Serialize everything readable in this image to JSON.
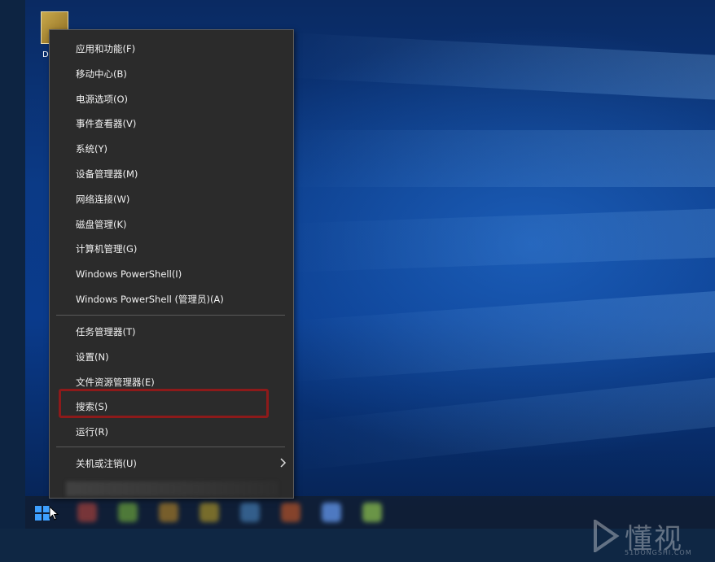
{
  "desktop": {
    "icon_label": "D"
  },
  "context_menu": {
    "group1": [
      {
        "label": "应用和功能(F)"
      },
      {
        "label": "移动中心(B)"
      },
      {
        "label": "电源选项(O)"
      },
      {
        "label": "事件查看器(V)"
      },
      {
        "label": "系统(Y)"
      },
      {
        "label": "设备管理器(M)"
      },
      {
        "label": "网络连接(W)"
      },
      {
        "label": "磁盘管理(K)"
      },
      {
        "label": "计算机管理(G)"
      },
      {
        "label": "Windows PowerShell(I)"
      },
      {
        "label": "Windows PowerShell (管理员)(A)"
      }
    ],
    "group2": [
      {
        "label": "任务管理器(T)"
      },
      {
        "label": "设置(N)"
      },
      {
        "label": "文件资源管理器(E)"
      },
      {
        "label": "搜索(S)"
      },
      {
        "label": "运行(R)"
      }
    ],
    "group3": [
      {
        "label": "关机或注销(U)"
      }
    ],
    "highlighted_item": "搜索(S)",
    "highlight_color": "#8d1a1a"
  },
  "taskbar": {
    "start_icon": "windows-logo-icon",
    "pinned_icon_colors": [
      "#8a3a3a",
      "#5a8a3a",
      "#8a6a2a",
      "#8a7a2a",
      "#3a6a9a",
      "#9a4a2a",
      "#5a8ada",
      "#7aaa4a"
    ]
  },
  "watermark": {
    "text": "懂视",
    "sub": "51DONGSHI.COM"
  }
}
